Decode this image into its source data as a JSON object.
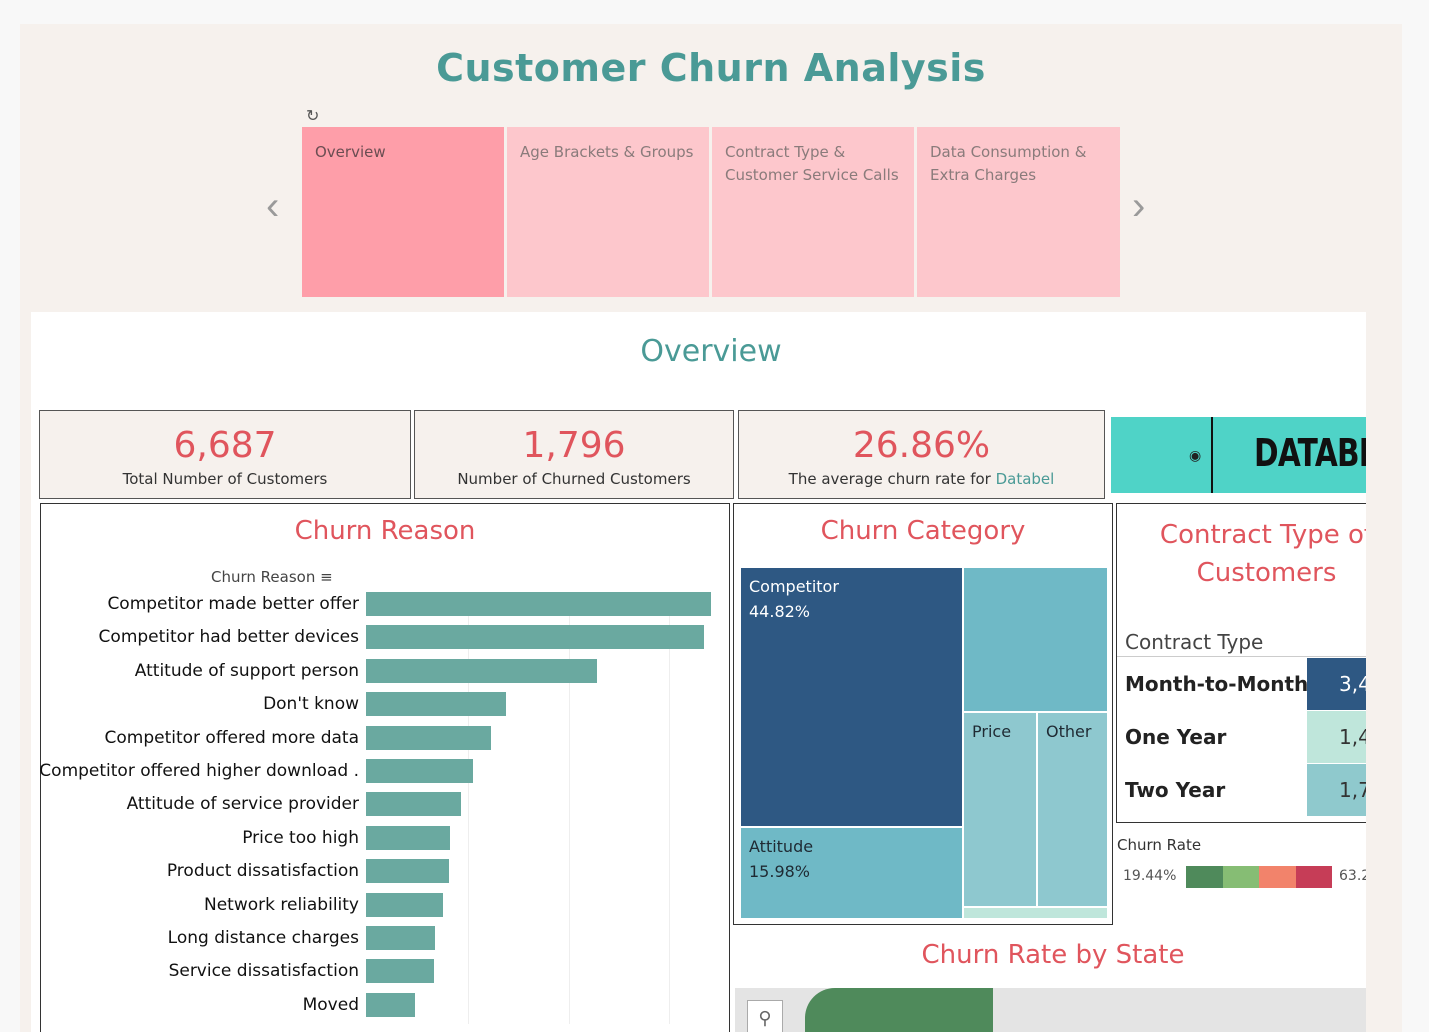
{
  "title": "Customer Churn Analysis",
  "nav": {
    "revert_icon": "revert-icon",
    "tabs": [
      "Overview",
      "Age Brackets & Groups",
      "Contract Type &\nCustomer Service Calls",
      "Data Consumption &\nExtra Charges"
    ],
    "active": "Overview"
  },
  "overview": {
    "title": "Overview",
    "kpis": [
      {
        "value": "6,687",
        "label": "Total Number of Customers"
      },
      {
        "value": "1,796",
        "label": "Number of Churned Customers"
      },
      {
        "value": "26.86%",
        "label_prefix": "The average churn rate for ",
        "label_highlight": "Databel"
      }
    ],
    "logo_text": "DATABEL"
  },
  "churn_reason": {
    "title": "Churn Reason",
    "header": "Churn Reason",
    "items": [
      "Competitor made better offer",
      "Competitor had better devices",
      "Attitude of support person",
      "Don't know",
      "Competitor offered more data",
      "Competitor offered higher download .",
      "Attitude of service provider",
      "Price too high",
      "Product dissatisfaction",
      "Network reliability",
      "Long distance charges",
      "Service dissatisfaction",
      "Moved"
    ]
  },
  "churn_category": {
    "title": "Churn Category",
    "cells": [
      {
        "name": "Competitor",
        "pct": "44.82%"
      },
      {
        "name": "Attitude",
        "pct": "15.98%"
      },
      {
        "name": "Price",
        "pct": ""
      },
      {
        "name": "Other",
        "pct": ""
      }
    ]
  },
  "contract_type": {
    "title": "Contract Type of Customers",
    "header": "Contract Type",
    "rows": [
      {
        "name": "Month-to-Month",
        "value": "3,4",
        "color": "#2e5883"
      },
      {
        "name": "One Year",
        "value": "1,4",
        "color": "#bfe6db"
      },
      {
        "name": "Two Year",
        "value": "1,7",
        "color": "#8fc9cd"
      }
    ],
    "legend_title": "Churn Rate",
    "legend_min": "19.44%",
    "legend_max": "63.2",
    "legend_colors": [
      "#4f8a5b",
      "#86bd74",
      "#f2836b",
      "#c63d57"
    ]
  },
  "state_map": {
    "title": "Churn Rate by State"
  }
}
